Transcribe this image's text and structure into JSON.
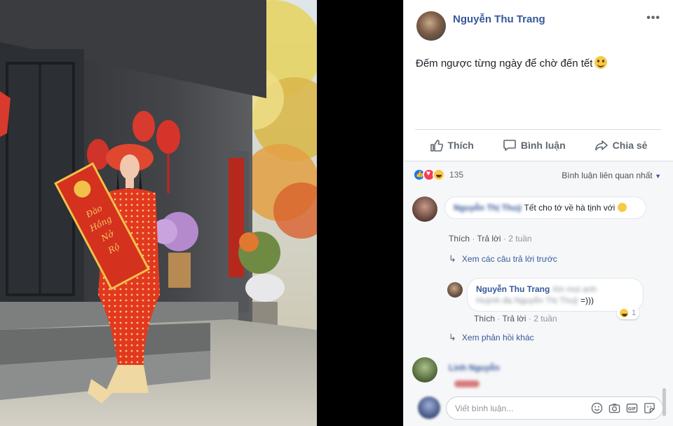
{
  "post": {
    "author": "Nguyễn Thu Trang",
    "text": "Đếm ngược từng ngày để chờ đến tết",
    "menu": "•••"
  },
  "actions": {
    "like": "Thích",
    "comment": "Bình luận",
    "share": "Chia sẻ"
  },
  "reactions": {
    "count": "135"
  },
  "sort": {
    "label": "Bình luận liên quan nhất"
  },
  "comments": [
    {
      "name": "Nguyễn Thị Thuỷ",
      "text": "Tết cho tớ về hà tịnh với",
      "like": "Thích",
      "reply": "Trả lời",
      "time": "2 tuần"
    }
  ],
  "view_previous": "Xem các câu trả lời trước",
  "reply": {
    "name": "Nguyễn Thu Trang",
    "text_line1": "Xin mọi anh",
    "text_line2": "Huỳnh đạ Nguyễn Thị Thuỷ ",
    "text_tail": "=)))",
    "like": "Thích",
    "reply": "Trả lời",
    "time": "2 tuần",
    "reaction_count": "1"
  },
  "view_more": "Xem phản hồi khác",
  "third_comment": {
    "name": "Linh Nguyễn"
  },
  "write": {
    "placeholder": "Viết bình luận..."
  },
  "colors": {
    "link": "#365899",
    "reaction_like": "#1877f2",
    "reaction_love": "#f33e58",
    "reaction_haha": "#f7c948"
  },
  "icons": [
    "like-icon",
    "comment-icon",
    "share-icon",
    "emoji-icon",
    "camera-icon",
    "gif-icon",
    "sticker-icon"
  ]
}
